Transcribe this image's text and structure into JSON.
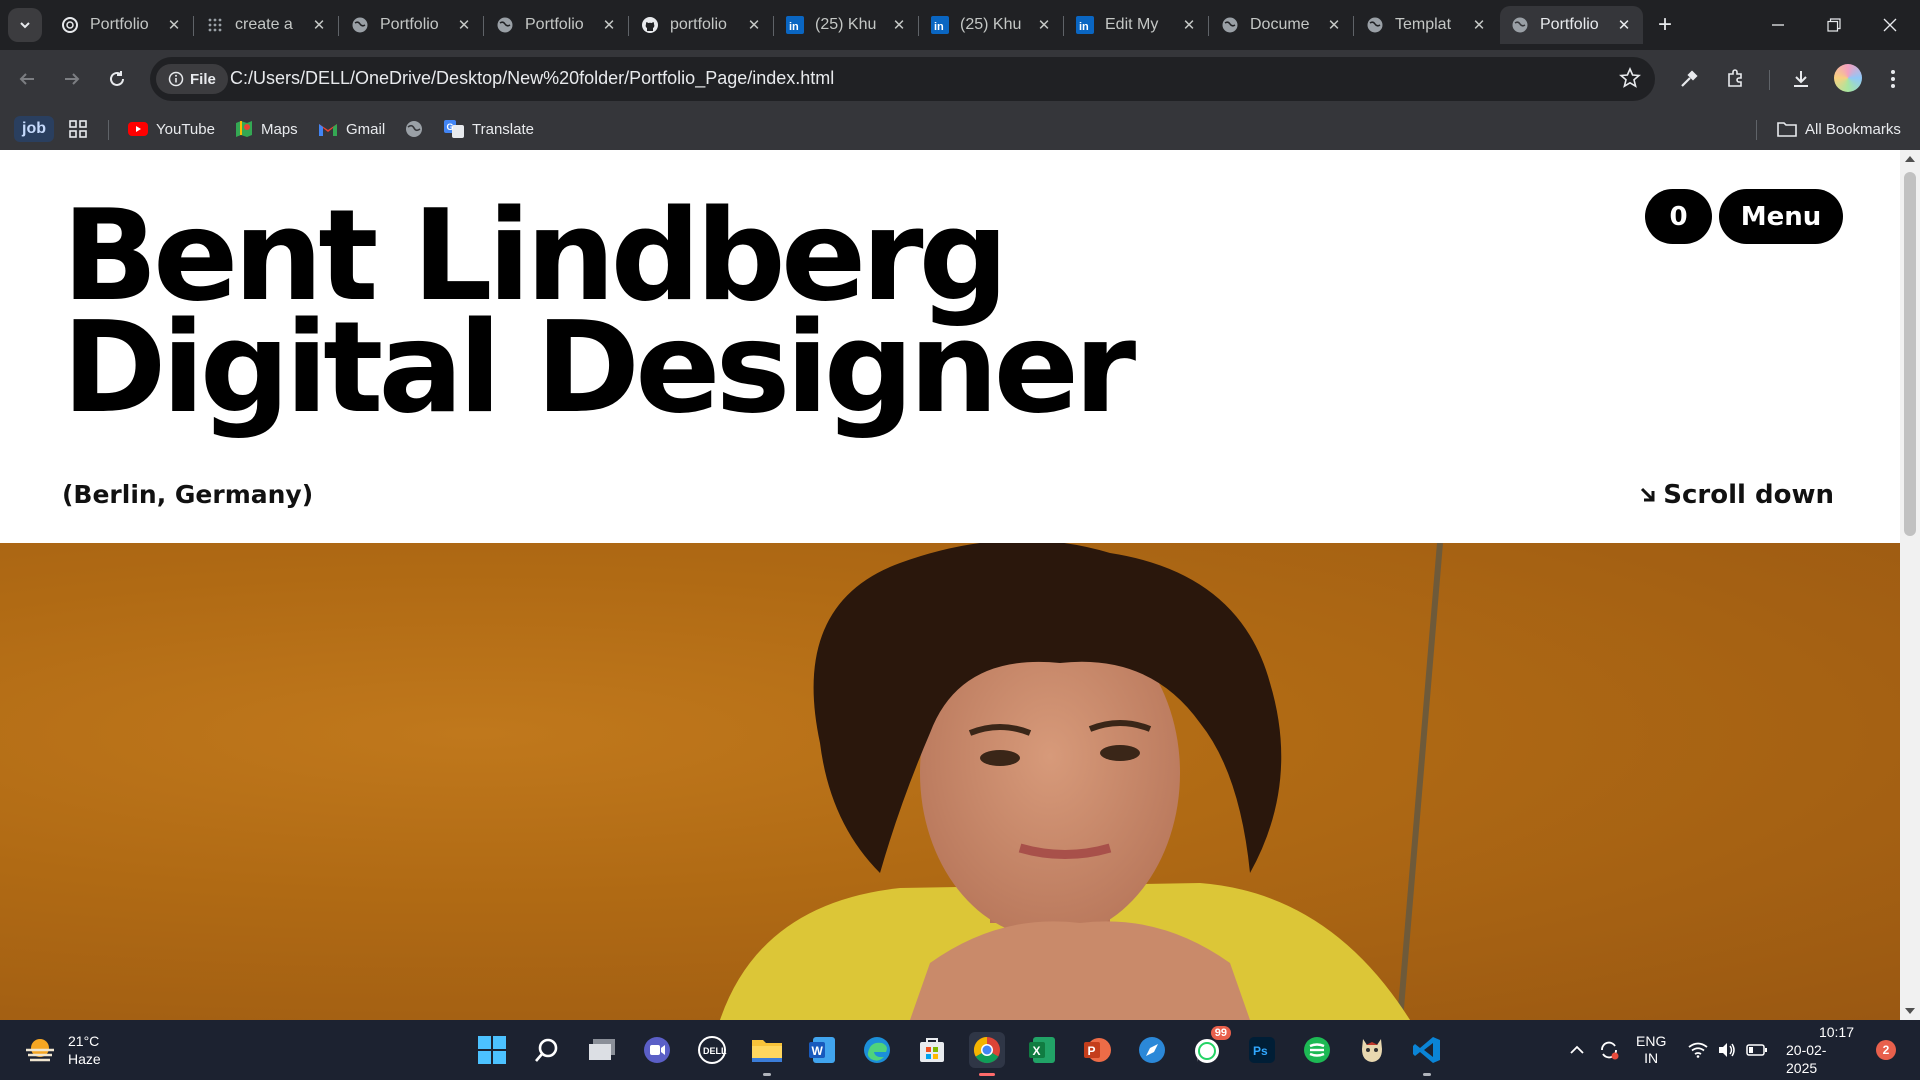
{
  "browser": {
    "tabs": [
      {
        "title": "Portfolio",
        "icon": "openai-icon",
        "active": false
      },
      {
        "title": "create a",
        "icon": "grid-dots-icon",
        "active": false
      },
      {
        "title": "Portfolio",
        "icon": "globe-icon",
        "active": false
      },
      {
        "title": "Portfolio",
        "icon": "globe-icon",
        "active": false
      },
      {
        "title": "portfolio",
        "icon": "github-icon",
        "active": false
      },
      {
        "title": "(25) Khu",
        "icon": "linkedin-icon",
        "active": false
      },
      {
        "title": "(25) Khu",
        "icon": "linkedin-icon",
        "active": false
      },
      {
        "title": "Edit My",
        "icon": "linkedin-icon",
        "active": false
      },
      {
        "title": "Docume",
        "icon": "globe-icon",
        "active": false
      },
      {
        "title": "Templat",
        "icon": "globe-icon",
        "active": false
      },
      {
        "title": "Portfolio",
        "icon": "globe-icon",
        "active": true
      }
    ],
    "site_chip": "File",
    "url": "C:/Users/DELL/OneDrive/Desktop/New%20folder/Portfolio_Page/index.html",
    "bookmarks": {
      "job": "job",
      "items": [
        {
          "label": "YouTube",
          "icon": "youtube-icon"
        },
        {
          "label": "Maps",
          "icon": "maps-icon"
        },
        {
          "label": "Gmail",
          "icon": "gmail-icon"
        },
        {
          "label": "",
          "icon": "globe-icon"
        },
        {
          "label": "Translate",
          "icon": "translate-icon"
        }
      ],
      "all_bookmarks": "All Bookmarks"
    }
  },
  "page": {
    "title_line1": "Bent Lindberg",
    "title_line2": "Digital Designer",
    "location": "(Berlin, Germany)",
    "scroll_label": "Scroll down",
    "counter": "0",
    "menu_label": "Menu",
    "image_bg": "#b06a14"
  },
  "taskbar": {
    "temperature": "21°C",
    "condition": "Haze",
    "whatsapp_badge": "99",
    "lang_line1": "ENG",
    "lang_line2": "IN",
    "time": "10:17",
    "date": "20-02-2025",
    "notification_count": "2"
  }
}
